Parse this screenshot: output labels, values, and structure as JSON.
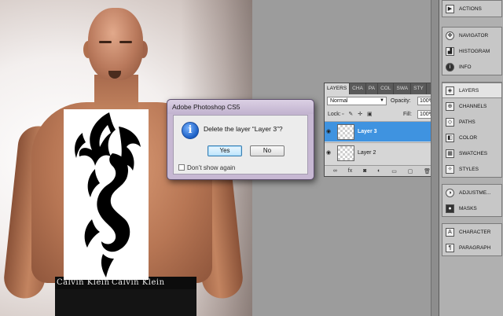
{
  "dialog": {
    "title": "Adobe Photoshop CS5",
    "message": "Delete the layer “Layer 3”?",
    "yes_label": "Yes",
    "no_label": "No",
    "checkbox_label": "Don’t show again",
    "icon": "info-icon"
  },
  "layers_panel": {
    "tabs": [
      "LAYERS",
      "CHA",
      "PA",
      "COL",
      "SWA",
      "STY"
    ],
    "blend_mode": "Normal",
    "opacity_label": "Opacity:",
    "opacity_value": "100%",
    "lock_label": "Lock:",
    "fill_label": "Fill:",
    "fill_value": "100%",
    "layers": [
      {
        "name": "Layer 3",
        "selected": true
      },
      {
        "name": "Layer 2",
        "selected": false
      }
    ]
  },
  "photo": {
    "brand_text": "Calvin Klein"
  },
  "dock": {
    "group1": [
      {
        "label": "ACTIONS",
        "icon": "play-icon"
      }
    ],
    "group2": [
      {
        "label": "NAVIGATOR",
        "icon": "compass-icon"
      },
      {
        "label": "HISTOGRAM",
        "icon": "histogram-icon"
      },
      {
        "label": "INFO",
        "icon": "info-icon"
      }
    ],
    "group3": [
      {
        "label": "LAYERS",
        "icon": "layers-icon"
      },
      {
        "label": "CHANNELS",
        "icon": "channels-icon"
      },
      {
        "label": "PATHS",
        "icon": "paths-icon"
      },
      {
        "label": "COLOR",
        "icon": "color-icon"
      },
      {
        "label": "SWATCHES",
        "icon": "swatches-icon"
      },
      {
        "label": "STYLES",
        "icon": "styles-icon"
      }
    ],
    "group4": [
      {
        "label": "ADJUSTME...",
        "icon": "adjustments-icon"
      },
      {
        "label": "MASKS",
        "icon": "masks-icon"
      }
    ],
    "group5": [
      {
        "label": "CHARACTER",
        "icon": "character-icon"
      },
      {
        "label": "PARAGRAPH",
        "icon": "paragraph-icon"
      }
    ]
  }
}
